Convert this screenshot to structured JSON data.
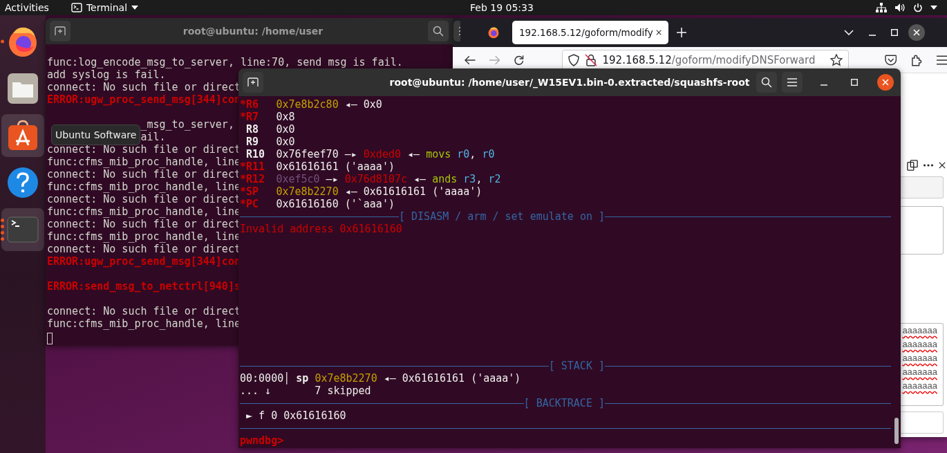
{
  "top_bar": {
    "activities": "Activities",
    "app_menu": "Terminal",
    "clock": "Feb 19  05:33"
  },
  "dock": [
    {
      "kind": "firefox",
      "highlighted": false,
      "running": true,
      "several_windows": false
    },
    {
      "kind": "files",
      "highlighted": false,
      "running": false
    },
    {
      "kind": "software",
      "highlighted": true,
      "running": false
    },
    {
      "kind": "help",
      "highlighted": false,
      "running": false
    },
    {
      "kind": "terminal",
      "highlighted": true,
      "running": true,
      "several_windows": true
    }
  ],
  "tooltip": "Ubuntu Software",
  "back_terminal": {
    "title": "root@ubuntu: /home/user",
    "focused": false,
    "cursor": true,
    "blocks": [
      [
        {
          "text": "func:log_encode_msg_to_server, line:70, send msg is fail.",
          "kind": "plain"
        },
        {
          "text": "add syslog is fail.",
          "kind": "plain"
        },
        {
          "text": "connect: No such file or direct",
          "kind": "plain"
        },
        {
          "text": "ERROR:ugw_proc_send_msg[344]con",
          "kind": "error"
        }
      ],
      [
        {
          "text": "               _msg_to_server,",
          "kind": "plain"
        },
        {
          "text": "               ail.",
          "kind": "plain"
        },
        {
          "text": "connect: No such file or direct",
          "kind": "plain"
        },
        {
          "text": "func:cfms_mib_proc_handle, line",
          "kind": "plain"
        },
        {
          "text": "connect: No such file or direct",
          "kind": "plain"
        },
        {
          "text": "func:cfms_mib_proc_handle, line",
          "kind": "plain"
        },
        {
          "text": "connect: No such file or direct",
          "kind": "plain"
        },
        {
          "text": "func:cfms_mib_proc_handle, line",
          "kind": "plain"
        },
        {
          "text": "connect: No such file or direct",
          "kind": "plain"
        },
        {
          "text": "func:cfms_mib_proc_handle, line",
          "kind": "plain"
        },
        {
          "text": "connect: No such file or direct",
          "kind": "plain"
        },
        {
          "text": "ERROR:ugw_proc_send_msg[344]con",
          "kind": "error"
        }
      ],
      [
        {
          "text": "ERROR:send_msg_to_netctrl[940]s",
          "kind": "error"
        }
      ],
      [
        {
          "text": "connect: No such file or direct",
          "kind": "plain"
        },
        {
          "text": "func:cfms_mib_proc_handle, line",
          "kind": "plain"
        }
      ]
    ]
  },
  "browser": {
    "tab": {
      "title": "192.168.5.12/goform/modify",
      "selected": true
    },
    "url_host": "192.168.5.12",
    "url_path": "/goform/modifyDNSForward",
    "textarea_lines": [
      "aaaaaaa",
      "aaaaaaa",
      "aaaaaaa",
      "aaaaaaa",
      "aaaaaaa"
    ]
  },
  "front_terminal": {
    "title": "root@ubuntu: /home/user/_W15EV1.bin-0.extracted/squashfs-root",
    "focused": true,
    "top": [
      {
        "kind": "register",
        "name": "*R6",
        "changed": true,
        "segments": [
          {
            "text": "0x7e8b2c80",
            "kind": "stack"
          },
          {
            "text": " ◂— 0x0",
            "kind": "plain"
          }
        ]
      },
      {
        "kind": "register",
        "name": "*R7",
        "changed": true,
        "segments": [
          {
            "text": "0x8",
            "kind": "plain"
          }
        ]
      },
      {
        "kind": "register",
        "name": "R8",
        "changed": false,
        "segments": [
          {
            "text": "0x0",
            "kind": "plain"
          }
        ]
      },
      {
        "kind": "register",
        "name": "R9",
        "changed": false,
        "segments": [
          {
            "text": "0x0",
            "kind": "plain"
          }
        ]
      },
      {
        "kind": "register",
        "name": "R10",
        "changed": false,
        "segments": [
          {
            "text": "0x76feef70 —▸ ",
            "kind": "plain"
          },
          {
            "text": "0xded0",
            "kind": "code"
          },
          {
            "text": " ◂— ",
            "kind": "plain"
          },
          {
            "text": "movs ",
            "kind": "mnemonic"
          },
          {
            "text": "r0",
            "kind": "operand"
          },
          {
            "text": ", ",
            "kind": "plain"
          },
          {
            "text": "r0",
            "kind": "operand"
          }
        ]
      },
      {
        "kind": "register",
        "name": "*R11",
        "changed": true,
        "segments": [
          {
            "text": "0x61616161 ('aaaa')",
            "kind": "plain"
          }
        ]
      },
      {
        "kind": "register",
        "name": "*R12",
        "changed": true,
        "segments": [
          {
            "text": "0xef5c0",
            "kind": "data"
          },
          {
            "text": " —▸ ",
            "kind": "plain"
          },
          {
            "text": "0x76d8107c",
            "kind": "code"
          },
          {
            "text": " ◂— ",
            "kind": "plain"
          },
          {
            "text": "ands ",
            "kind": "mnemonic"
          },
          {
            "text": "r3",
            "kind": "operand"
          },
          {
            "text": ", ",
            "kind": "plain"
          },
          {
            "text": "r2",
            "kind": "operand"
          }
        ]
      },
      {
        "kind": "register",
        "name": "*SP",
        "changed": true,
        "segments": [
          {
            "text": "0x7e8b2270",
            "kind": "stack"
          },
          {
            "text": " ◂— 0x61616161 ('aaaa')",
            "kind": "plain"
          }
        ]
      },
      {
        "kind": "register",
        "name": "*PC",
        "changed": true,
        "segments": [
          {
            "text": "0x61616160 ('`aaa')",
            "kind": "plain"
          }
        ]
      },
      {
        "kind": "rule",
        "title": "[ DISASM / arm / set emulate on ]"
      },
      {
        "kind": "text",
        "segments": [
          {
            "text": "Invalid address 0x61616160",
            "kind": "code"
          }
        ]
      }
    ],
    "bottom": [
      {
        "kind": "rule",
        "title": "[ STACK ]"
      },
      {
        "kind": "text",
        "segments": [
          {
            "text": "00:0000│ ",
            "kind": "plain"
          },
          {
            "text": "sp ",
            "kind": "bold"
          },
          {
            "text": "0x7e8b2270",
            "kind": "stack"
          },
          {
            "text": " ◂— 0x61616161 ('aaaa')",
            "kind": "plain"
          }
        ]
      },
      {
        "kind": "text",
        "segments": [
          {
            "text": "... ↓       7 skipped",
            "kind": "plain"
          }
        ]
      },
      {
        "kind": "rule",
        "title": "[ BACKTRACE ]"
      },
      {
        "kind": "text",
        "segments": [
          {
            "text": "►",
            "kind": "marker"
          },
          {
            "text": " f 0 0x61616160",
            "kind": "plain"
          }
        ]
      },
      {
        "kind": "rule"
      },
      {
        "kind": "text",
        "segments": [
          {
            "text": "pwndbg>",
            "kind": "prompt"
          }
        ]
      }
    ]
  }
}
